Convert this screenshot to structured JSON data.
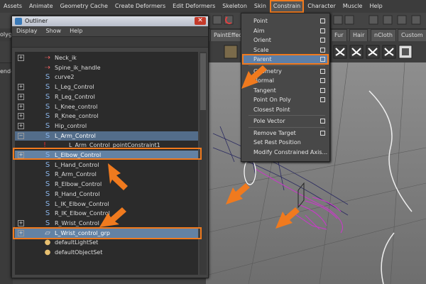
{
  "menubar": [
    "Assets",
    "Animate",
    "Geometry Cache",
    "Create Deformers",
    "Edit Deformers",
    "Skeleton",
    "Skin",
    "Constrain",
    "Character",
    "Muscle",
    "Help"
  ],
  "shelf_tabs": [
    "PaintEffects",
    "Fur",
    "Hair",
    "nCloth",
    "Custom"
  ],
  "partial_labels": {
    "left_toolbar": "olyg",
    "left_panel": "ende"
  },
  "outliner": {
    "title": "Outliner",
    "menu": [
      "Display",
      "Show",
      "Help"
    ],
    "items": [
      {
        "label": "Neck_ik",
        "icon": "ik-handle-icon",
        "expand": "+"
      },
      {
        "label": "Spine_ik_handle",
        "icon": "ik-handle-icon",
        "expand": ""
      },
      {
        "label": "curve2",
        "icon": "curve-icon",
        "expand": ""
      },
      {
        "label": "L_Leg_Control",
        "icon": "curve-icon",
        "expand": "+"
      },
      {
        "label": "R_Leg_Control",
        "icon": "curve-icon",
        "expand": "+"
      },
      {
        "label": "L_Knee_control",
        "icon": "curve-icon",
        "expand": "+"
      },
      {
        "label": "R_Knee_control",
        "icon": "curve-icon",
        "expand": "+"
      },
      {
        "label": "Hip_control",
        "icon": "curve-icon",
        "expand": "+"
      },
      {
        "label": "L_Arm_Control",
        "icon": "curve-icon",
        "expand": "−"
      },
      {
        "label": "L_Arm_Control_pointConstraint1",
        "icon": "constraint-icon",
        "expand": ""
      },
      {
        "label": "L_Elbow_Control",
        "icon": "curve-icon",
        "expand": "+"
      },
      {
        "label": "L_Hand_Control",
        "icon": "curve-icon",
        "expand": ""
      },
      {
        "label": "R_Arm_Control",
        "icon": "curve-icon",
        "expand": ""
      },
      {
        "label": "R_Elbow_Control",
        "icon": "curve-icon",
        "expand": ""
      },
      {
        "label": "R_Hand_Control",
        "icon": "curve-icon",
        "expand": ""
      },
      {
        "label": "L_IK_Elbow_Control",
        "icon": "curve-icon",
        "expand": ""
      },
      {
        "label": "R_IK_Elbow_Control",
        "icon": "curve-icon",
        "expand": ""
      },
      {
        "label": "R_Wrist_Control",
        "icon": "curve-icon",
        "expand": "+"
      },
      {
        "label": "L_Wrist_control_grp",
        "icon": "group-icon",
        "expand": "+"
      },
      {
        "label": "defaultLightSet",
        "icon": "set-icon",
        "expand": ""
      },
      {
        "label": "defaultObjectSet",
        "icon": "set-icon",
        "expand": ""
      }
    ]
  },
  "constrain_menu": [
    {
      "label": "Point",
      "box": true
    },
    {
      "label": "Aim",
      "box": true
    },
    {
      "label": "Orient",
      "box": true
    },
    {
      "label": "Scale",
      "box": true
    },
    {
      "label": "Parent",
      "box": true
    },
    {
      "label": "Geometry",
      "box": true
    },
    {
      "label": "Normal",
      "box": true
    },
    {
      "label": "Tangent",
      "box": true
    },
    {
      "label": "Point On Poly",
      "box": true
    },
    {
      "label": "Closest Point",
      "box": false
    },
    {
      "label": "Pole Vector",
      "box": true
    },
    {
      "label": "Remove Target",
      "box": true
    },
    {
      "label": "Set Rest Position",
      "box": false
    },
    {
      "label": "Modify Constrained Axis...",
      "box": false
    }
  ],
  "colors": {
    "highlight": "#f07a1e",
    "selection": "#6382a4",
    "constraint_red": "#e03030",
    "wire": "#c040c0"
  }
}
